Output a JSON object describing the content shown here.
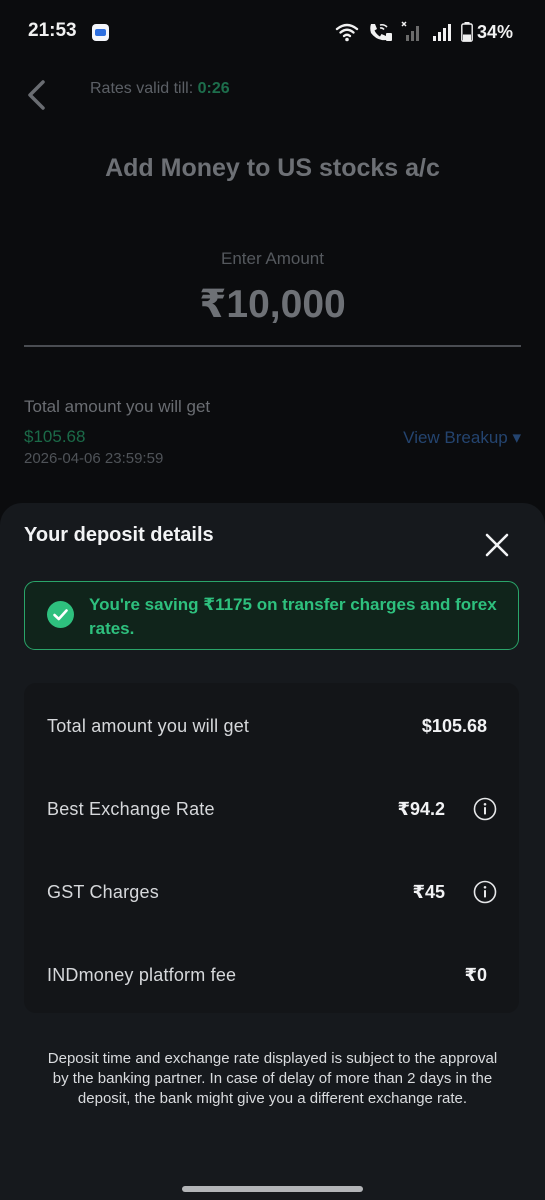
{
  "status_bar": {
    "time": "21:53",
    "battery": "34%",
    "icons": [
      "app-notification-icon",
      "wifi-icon",
      "wifi-calling-icon",
      "signal-muted-icon",
      "signal-icon",
      "battery-icon"
    ]
  },
  "background_page": {
    "rates_valid_label": "Rates valid till:",
    "rates_valid_timer": "0:26",
    "title": "Add Money to US stocks a/c",
    "enter_amount_label": "Enter Amount",
    "amount": "₹10,000",
    "total_label": "Total amount you will get",
    "total_value": "$105.68",
    "total_date": "2026-04-06 23:59:59",
    "view_breakup": "View Breakup ▾"
  },
  "sheet": {
    "title": "Your deposit details",
    "savings_message": "You're saving ₹1175 on transfer charges and forex rates.",
    "details": [
      {
        "label": "Total amount you will get",
        "value": "$105.68",
        "info": false
      },
      {
        "label": "Best Exchange Rate",
        "value": "₹94.2",
        "info": true
      },
      {
        "label": "GST Charges",
        "value": "₹45",
        "info": true
      },
      {
        "label": "INDmoney platform fee",
        "value": "₹0",
        "info": false
      }
    ],
    "disclaimer": "Deposit time and exchange rate displayed is subject to the approval by the banking partner. In case of delay of more than 2 days in the deposit, the bank might give you a different exchange rate."
  },
  "colors": {
    "accent_green": "#2ec07e",
    "banner_border": "#2aa56a",
    "link_blue": "#24446f",
    "sheet_bg": "#16191d"
  }
}
